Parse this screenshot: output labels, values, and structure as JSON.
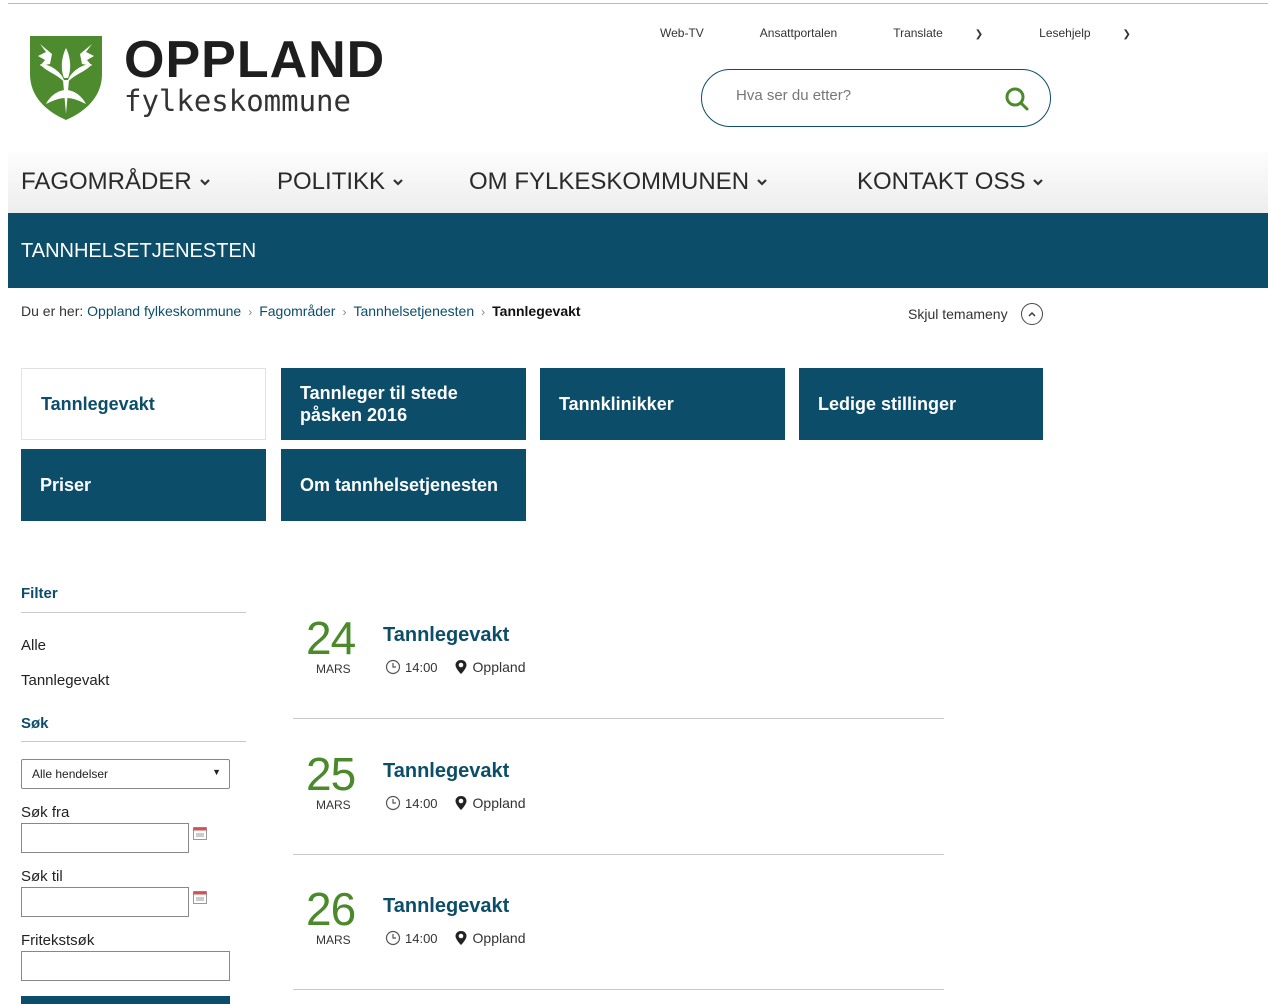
{
  "header": {
    "logo_name": "OPPLAND",
    "logo_sub": "fylkeskommune",
    "toplinks": [
      {
        "label": "Web-TV",
        "chevron": false
      },
      {
        "label": "Ansattportalen",
        "chevron": false
      },
      {
        "label": "Translate",
        "chevron": true
      },
      {
        "label": "Lesehjelp",
        "chevron": true
      }
    ],
    "search_placeholder": "Hva ser du etter?"
  },
  "nav": {
    "items": [
      "FAGOMRÅDER",
      "POLITIKK",
      "OM FYLKESKOMMUNEN",
      "KONTAKT OSS"
    ]
  },
  "section": {
    "title": "TANNHELSETJENESTEN"
  },
  "breadcrumb": {
    "prefix": "Du er her:",
    "items": [
      "Oppland fylkeskommune",
      "Fagområder",
      "Tannhelsetjenesten"
    ],
    "current": "Tannlegevakt",
    "hide_menu": "Skjul temameny"
  },
  "tiles": [
    {
      "label": "Tannlegevakt",
      "active": true
    },
    {
      "label": "Tannleger til stede påsken 2016",
      "active": false
    },
    {
      "label": "Tannklinikker",
      "active": false
    },
    {
      "label": "Ledige stillinger",
      "active": false
    },
    {
      "label": "Priser",
      "active": false
    },
    {
      "label": "Om tannhelsetjenesten",
      "active": false
    }
  ],
  "filter": {
    "heading": "Filter",
    "options": [
      "Alle",
      "Tannlegevakt"
    ],
    "search_heading": "Søk",
    "select_value": "Alle hendelser",
    "from_label": "Søk fra",
    "to_label": "Søk til",
    "freetext_label": "Fritekstsøk",
    "from_value": "",
    "to_value": "",
    "freetext_value": ""
  },
  "events": [
    {
      "day": "24",
      "month": "MARS",
      "title": "Tannlegevakt",
      "time": "14:00",
      "place": "Oppland"
    },
    {
      "day": "25",
      "month": "MARS",
      "title": "Tannlegevakt",
      "time": "14:00",
      "place": "Oppland"
    },
    {
      "day": "26",
      "month": "MARS",
      "title": "Tannlegevakt",
      "time": "14:00",
      "place": "Oppland"
    }
  ],
  "colors": {
    "brand_blue": "#0c4d6a",
    "brand_green": "#4a8a2a"
  }
}
